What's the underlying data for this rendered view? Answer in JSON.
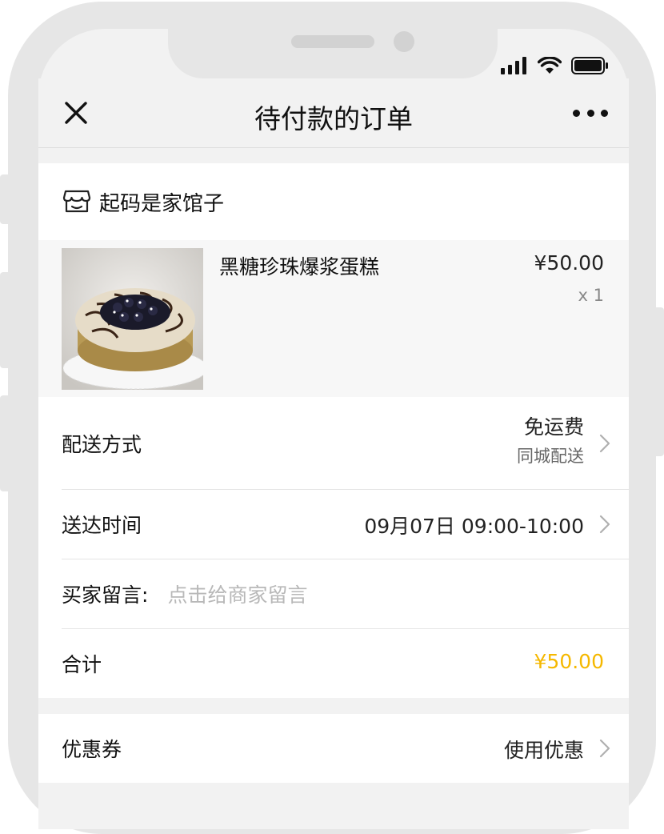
{
  "nav": {
    "title": "待付款的订单"
  },
  "store": {
    "name": "起码是家馆子"
  },
  "product": {
    "name": "黑糖珍珠爆浆蛋糕",
    "price": "¥50.00",
    "quantity": "x 1"
  },
  "delivery": {
    "label": "配送方式",
    "fee": "免运费",
    "method": "同城配送"
  },
  "arrival": {
    "label": "送达时间",
    "value": "09月07日 09:00-10:00"
  },
  "message": {
    "label": "买家留言:",
    "placeholder": "点击给商家留言"
  },
  "total": {
    "label": "合计",
    "value": "¥50.00"
  },
  "coupon": {
    "label": "优惠券",
    "action": "使用优惠"
  },
  "colors": {
    "accent_total": "#f5b800",
    "background": "#f2f2f2",
    "text_primary": "#111111",
    "text_secondary": "#888888"
  }
}
